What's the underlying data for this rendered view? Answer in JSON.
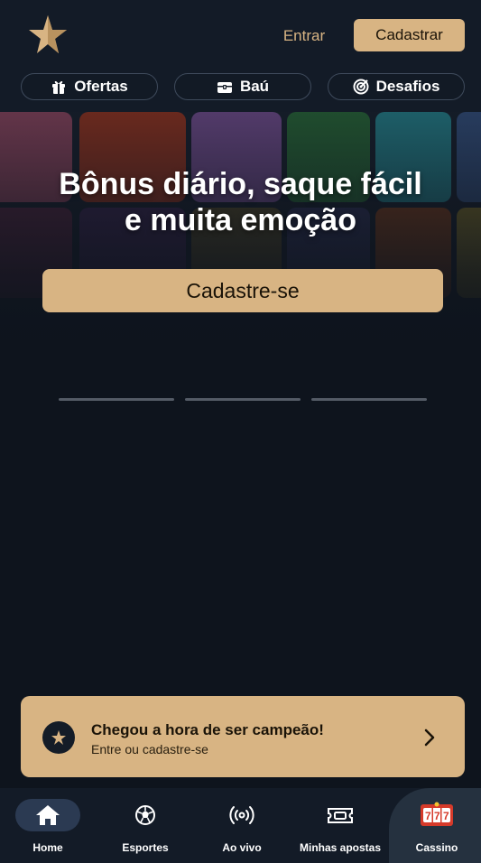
{
  "header": {
    "login_label": "Entrar",
    "register_label": "Cadastrar",
    "brand_color": "#d8b483"
  },
  "quick_links": [
    {
      "label": "Ofertas",
      "icon": "gift-icon"
    },
    {
      "label": "Baú",
      "icon": "chest-icon"
    },
    {
      "label": "Desafios",
      "icon": "target-icon"
    }
  ],
  "banner": {
    "title": "Bônus diário, saque fácil\ne muita emoção",
    "cta_label": "Cadastre-se"
  },
  "pager": {
    "count": 3
  },
  "promo": {
    "title": "Chegou a hora de ser campeão!",
    "subtitle": "Entre ou cadastre-se",
    "icon": "star-icon"
  },
  "bottom_nav": [
    {
      "label": "Home",
      "icon": "home-icon",
      "active": true
    },
    {
      "label": "Esportes",
      "icon": "soccer-ball-icon"
    },
    {
      "label": "Ao vivo",
      "icon": "live-broadcast-icon"
    },
    {
      "label": "Minhas apostas",
      "icon": "ticket-icon"
    },
    {
      "label": "Cassino",
      "icon": "slot-machine-icon",
      "highlighted": true
    }
  ]
}
